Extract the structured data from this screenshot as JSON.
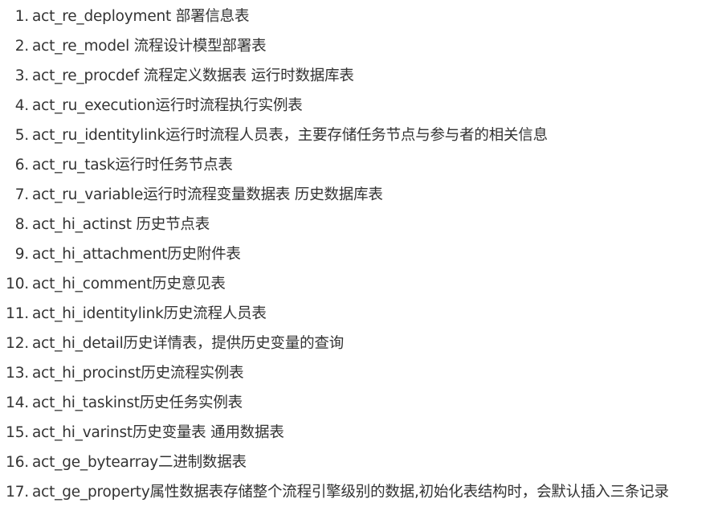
{
  "items": [
    {
      "num": "1.",
      "text": "act_re_deployment 部署信息表"
    },
    {
      "num": "2.",
      "text": "act_re_model 流程设计模型部署表"
    },
    {
      "num": "3.",
      "text": "act_re_procdef 流程定义数据表 运行时数据库表"
    },
    {
      "num": "4.",
      "text": "act_ru_execution运行时流程执行实例表"
    },
    {
      "num": "5.",
      "text": "act_ru_identitylink运行时流程人员表，主要存储任务节点与参与者的相关信息"
    },
    {
      "num": "6.",
      "text": "act_ru_task运行时任务节点表"
    },
    {
      "num": "7.",
      "text": "act_ru_variable运行时流程变量数据表 历史数据库表"
    },
    {
      "num": "8.",
      "text": "act_hi_actinst 历史节点表"
    },
    {
      "num": "9.",
      "text": "act_hi_attachment历史附件表"
    },
    {
      "num": "10.",
      "text": "act_hi_comment历史意见表"
    },
    {
      "num": "11.",
      "text": "act_hi_identitylink历史流程人员表"
    },
    {
      "num": "12.",
      "text": "act_hi_detail历史详情表，提供历史变量的查询"
    },
    {
      "num": "13.",
      "text": "act_hi_procinst历史流程实例表"
    },
    {
      "num": "14.",
      "text": "act_hi_taskinst历史任务实例表"
    },
    {
      "num": "15.",
      "text": "act_hi_varinst历史变量表 通用数据表"
    },
    {
      "num": "16.",
      "text": "act_ge_bytearray二进制数据表"
    },
    {
      "num": "17.",
      "text": "act_ge_property属性数据表存储整个流程引擎级别的数据,初始化表结构时，会默认插入三条记录"
    }
  ]
}
